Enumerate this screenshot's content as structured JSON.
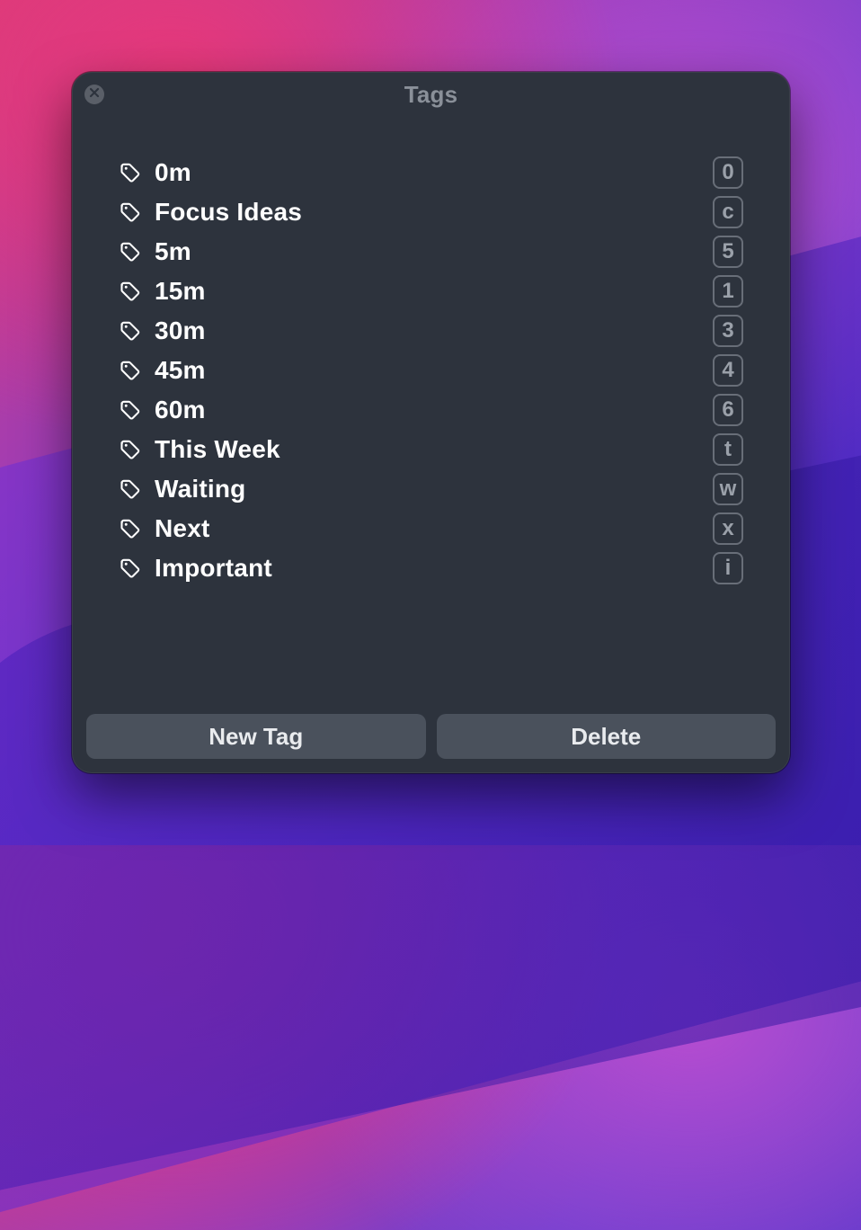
{
  "header": {
    "title": "Tags"
  },
  "tags": [
    {
      "label": "0m",
      "shortcut": "0"
    },
    {
      "label": "Focus Ideas",
      "shortcut": "c"
    },
    {
      "label": "5m",
      "shortcut": "5"
    },
    {
      "label": "15m",
      "shortcut": "1"
    },
    {
      "label": "30m",
      "shortcut": "3"
    },
    {
      "label": "45m",
      "shortcut": "4"
    },
    {
      "label": "60m",
      "shortcut": "6"
    },
    {
      "label": "This Week",
      "shortcut": "t"
    },
    {
      "label": "Waiting",
      "shortcut": "w"
    },
    {
      "label": "Next",
      "shortcut": "x"
    },
    {
      "label": "Important",
      "shortcut": "i"
    }
  ],
  "footer": {
    "new_tag_label": "New Tag",
    "delete_label": "Delete"
  }
}
